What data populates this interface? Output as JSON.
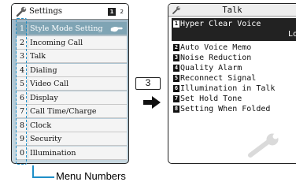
{
  "left_screen": {
    "title": "Settings",
    "page_current": "1",
    "page_total": "2",
    "menu": [
      {
        "num": "1",
        "label": "Style Mode Setting",
        "selected": true
      },
      {
        "num": "2",
        "label": "Incoming Call"
      },
      {
        "num": "3",
        "label": "Talk"
      },
      {
        "num": "4",
        "label": "Dialing"
      },
      {
        "num": "5",
        "label": "Video Call"
      },
      {
        "num": "6",
        "label": "Display"
      },
      {
        "num": "7",
        "label": "Call Time/Charge"
      },
      {
        "num": "8",
        "label": "Clock"
      },
      {
        "num": "9",
        "label": "Security"
      },
      {
        "num": "0",
        "label": "Illumination"
      }
    ]
  },
  "key_press": "3",
  "callout": {
    "label": "Menu Numbers",
    "color": "#1e8fc8"
  },
  "right_screen": {
    "title": "Talk",
    "items": [
      {
        "num": "1",
        "label": "Hyper Clear Voice",
        "value": "Lo",
        "highlighted": true
      },
      {
        "num": "2",
        "label": "Auto Voice Memo"
      },
      {
        "num": "3",
        "label": "Noise Reduction"
      },
      {
        "num": "4",
        "label": "Quality Alarm"
      },
      {
        "num": "5",
        "label": "Reconnect Signal"
      },
      {
        "num": "6",
        "label": "Illumination in Talk"
      },
      {
        "num": "7",
        "label": "Set Hold Tone"
      },
      {
        "num": "8",
        "label": "Setting When Folded"
      }
    ]
  }
}
